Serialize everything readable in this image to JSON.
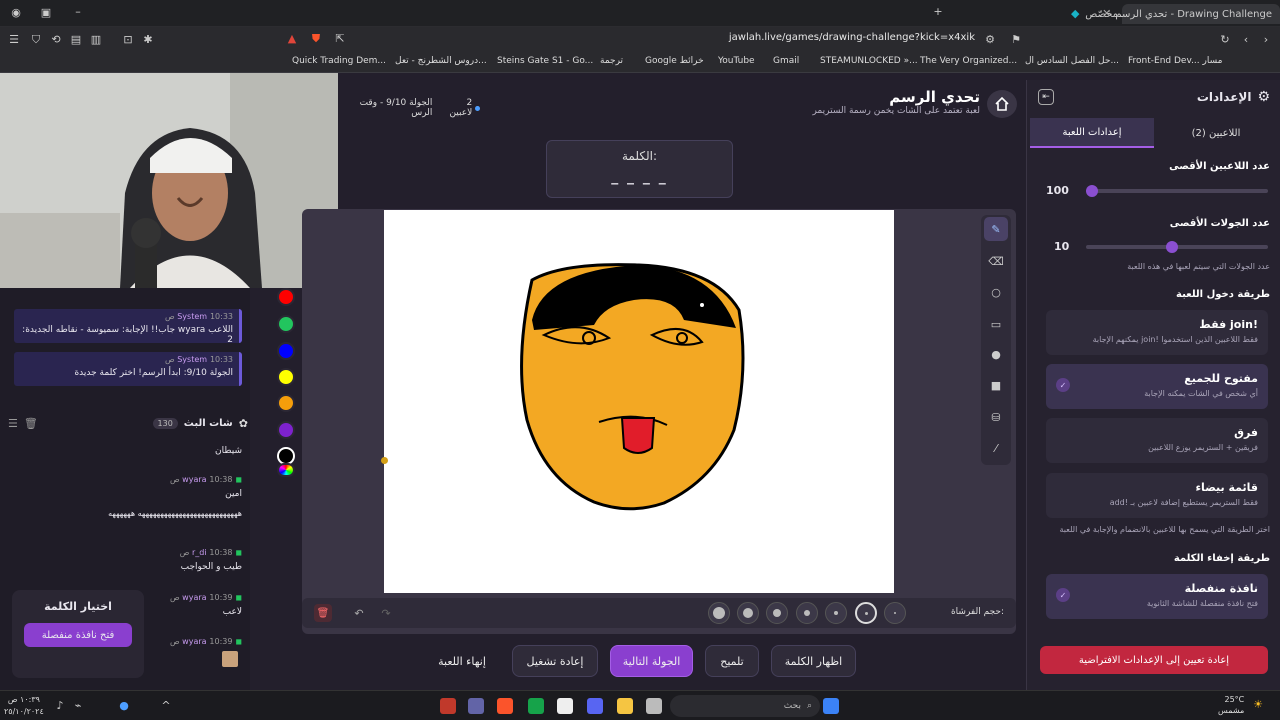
{
  "browser": {
    "tabs": [
      {
        "label": "Drawing Challenge - تحدي الرسم",
        "active": true
      },
      {
        "label": "مخصّص",
        "active": false
      }
    ],
    "url": "jawlah.live/games/drawing-challenge?kick=x4xik",
    "bookmarks": [
      "Quick Trading Dem...",
      "دروس الشطرنج - تعل...",
      "Steins Gate S1 - Go...",
      "ترجمة",
      "Google خرائط",
      "YouTube",
      "Gmail",
      "STEAMUNLOCKED »...",
      "The Very Organized...",
      "حل الفصل السادس ال...",
      "Front-End Dev... مسار"
    ]
  },
  "game": {
    "title": "تحدي الرسم",
    "subtitle": "لعبة تعتمد على الشات يخمن رسمة الستريمر",
    "players_count": "2 لاعبين",
    "round_info": "الجولة 9/10 - وقت الرس",
    "word_label": "الكلمة:",
    "word_mask": "_ _ _ _",
    "brush_label": "حجم الفرشاة:"
  },
  "colors": {
    "palette": [
      "#ff0000",
      "#22c55e",
      "#0000ff",
      "#ffff00",
      "#f59e0b",
      "#7e22ce",
      "#000000"
    ],
    "accent": "#8a4fd0",
    "face_fill": "#f3a823",
    "tongue": "#e11d2a"
  },
  "tools": [
    "pencil-icon",
    "eraser-icon",
    "circle-icon",
    "square-icon",
    "filled-circle-icon",
    "filled-square-icon",
    "bucket-icon",
    "line-icon"
  ],
  "actions": {
    "end_game": "إنهاء اللعبة",
    "restart": "إعادة تشغيل",
    "next_round": "الجولة التالية",
    "hint": "تلميح",
    "show_word": "اظهار الكلمة"
  },
  "settings": {
    "header": "الإعدادات",
    "tab_game": "إعدادات اللعبة",
    "tab_players": "اللاعبين (2)",
    "max_players_label": "عدد اللاعبين الأقصى",
    "max_players_value": "100",
    "max_players_fraction": 0.0,
    "max_rounds_label": "عدد الجولات الأقصى",
    "max_rounds_value": "10",
    "max_rounds_fraction": 0.47,
    "max_rounds_hint": "عدد الجولات التي سيتم لعبها في هذه اللعبة",
    "join_method_label": "طريقة دخول اللعبة",
    "join_options": [
      {
        "title": "!join فقط",
        "desc": "فقط اللاعبين الذين استخدموا !join يمكنهم الإجابة",
        "selected": false
      },
      {
        "title": "مفتوح للجميع",
        "desc": "أي شخص في الشات يمكنه الإجابة",
        "selected": true
      },
      {
        "title": "فرق",
        "desc": "فريقين + الستريمر يوزع اللاعبين",
        "selected": false
      },
      {
        "title": "قائمة بيضاء",
        "desc": "فقط الستريمر يستطيع إضافة لاعبين بـ !add",
        "selected": false
      }
    ],
    "join_hint": "اختر الطريقة التي يسمح بها للاعبين بالانضمام والإجابة في اللعبة",
    "hide_method_label": "طريقة إخفاء الكلمة",
    "hide_option": {
      "title": "نافذة منفصلة",
      "desc": "فتح نافذة منفصلة للشاشة الثانوية",
      "selected": true
    },
    "reset_button": "إعادة تعيين إلى الإعدادات الافتراضية"
  },
  "chat": {
    "system_messages": [
      {
        "user": "System",
        "time": "10:33 ص",
        "text": "اللاعب wyara جاب!! الإجابة: سميوسة - نقاطه الجديدة: 2"
      },
      {
        "user": "System",
        "time": "10:33 ص",
        "text": "الجولة 9/10: ابدأ الرسم! اختر كلمة جديدة"
      }
    ],
    "stream_chat_title": "شات البث",
    "viewer_count": "130",
    "messages": [
      {
        "user": "",
        "time": "",
        "text": "شيطان"
      },
      {
        "user": "wyara",
        "time": "10:38 ص",
        "text": "امين"
      },
      {
        "user": "",
        "time": "",
        "text": "هههههههههههههههههههههههههههه ههههههه"
      },
      {
        "user": "r_di",
        "time": "10:38 ص",
        "text": "طيب و الحواجب"
      },
      {
        "user": "wyara",
        "time": "10:39 ص",
        "text": "لاعب"
      },
      {
        "user": "wyara",
        "time": "10:39 ص",
        "text": ""
      }
    ],
    "choose_word_title": "اختيار الكلمة",
    "open_window_button": "فتح نافذة منفصلة"
  },
  "taskbar": {
    "search": "بحث",
    "weather": "25°C",
    "weather_desc": "مشمس",
    "time": "١٠:٣٩ ص",
    "date": "٢٥/١٠/٢٠٢٤"
  }
}
